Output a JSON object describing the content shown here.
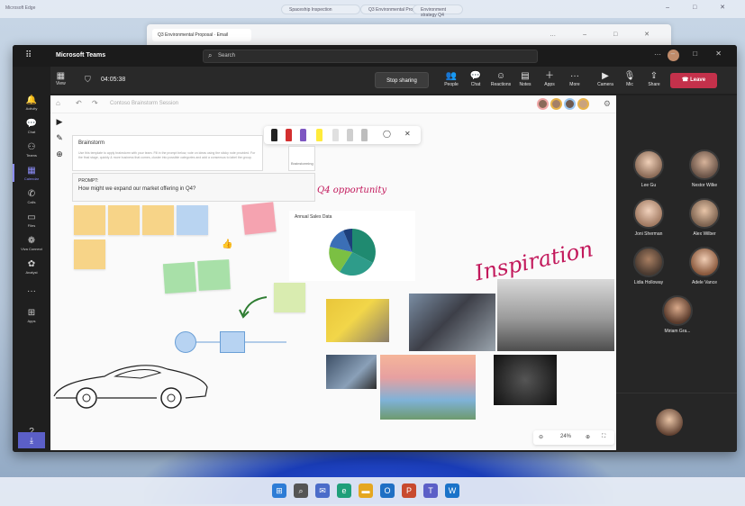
{
  "browser": {
    "app_name": "Microsoft Edge",
    "address_left": "Spaceship Inspection",
    "address_mid": "Q3 Environmental Project",
    "address_right": "Environment strategy Q4"
  },
  "outlook": {
    "tab_label": "Q3 Environmental Proposal · Email"
  },
  "teams": {
    "app_title": "Microsoft Teams",
    "search_placeholder": "Search",
    "view_label": "View",
    "timer": "04:05:38",
    "stop_sharing": "Stop sharing",
    "toolbar": [
      {
        "label": "People",
        "icon": "people-icon"
      },
      {
        "label": "Chat",
        "icon": "chat-icon"
      },
      {
        "label": "Reactions",
        "icon": "reactions-icon"
      },
      {
        "label": "Notes",
        "icon": "notes-icon"
      },
      {
        "label": "Apps",
        "icon": "apps-icon"
      },
      {
        "label": "More",
        "icon": "more-icon"
      },
      {
        "label": "Camera",
        "icon": "camera-icon"
      },
      {
        "label": "Mic",
        "icon": "mic-icon"
      },
      {
        "label": "Share",
        "icon": "share-icon"
      }
    ],
    "leave": "Leave",
    "rail": [
      {
        "label": "Activity",
        "icon": "bell-icon"
      },
      {
        "label": "Chat",
        "icon": "chat-icon"
      },
      {
        "label": "Teams",
        "icon": "teams-icon"
      },
      {
        "label": "Calendar",
        "icon": "calendar-icon"
      },
      {
        "label": "Calls",
        "icon": "phone-icon"
      },
      {
        "label": "Files",
        "icon": "files-icon"
      },
      {
        "label": "Viva Connect",
        "icon": "viva-icon"
      },
      {
        "label": "Analyst",
        "icon": "analyst-icon"
      },
      {
        "label": "Apps",
        "icon": "apps-icon"
      },
      {
        "label": "Help",
        "icon": "help-icon"
      }
    ]
  },
  "whiteboard": {
    "title": "Contoso Brainstorm Session",
    "brainstorm_heading": "Brainstorm",
    "brainstorm_body": "Use this template to apply brainstorm with your team. Fill in the prompt below, vote on ideas using the sticky note provided. For the final stage, quickly & more business that comes, cluster into possible categories and add a consensus to label the group.",
    "side_note": "Brainstorming",
    "prompt_label": "PROMPT:",
    "prompt_question": "How might we expand our market offering in Q4?",
    "chart_title": "Annual Sales Data",
    "q4_annotation": "Q4 opportunity",
    "inspiration": "Inspiration",
    "zoom": "24%",
    "colors": {
      "accent": "#c2185b",
      "sticky_yellow": "#f7d488",
      "sticky_blue": "#b9d4f1",
      "sticky_pink": "#f5a3b0",
      "sticky_green": "#a8e0a8"
    }
  },
  "participants": [
    {
      "name": "Lee Gu"
    },
    {
      "name": "Nestor Wilke"
    },
    {
      "name": "Joni Sherman"
    },
    {
      "name": "Alex Wilber"
    },
    {
      "name": "Lidia Holloway"
    },
    {
      "name": "Adele Vance"
    },
    {
      "name": "Miriam Gra..."
    }
  ]
}
